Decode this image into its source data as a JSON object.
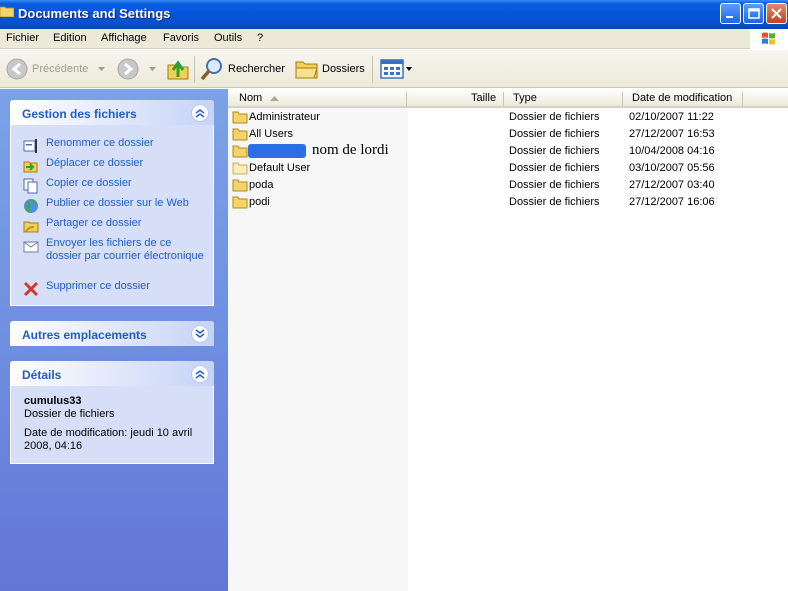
{
  "window": {
    "title": "Documents and Settings"
  },
  "menu": [
    "Fichier",
    "Edition",
    "Affichage",
    "Favoris",
    "Outils",
    "?"
  ],
  "toolbar": {
    "back_label": "Précédente",
    "search_label": "Rechercher",
    "folders_label": "Dossiers"
  },
  "file_tasks": {
    "title": "Gestion des fichiers",
    "items": [
      {
        "label": "Renommer ce dossier",
        "icon": "rename-icon"
      },
      {
        "label": "Déplacer ce dossier",
        "icon": "move-icon"
      },
      {
        "label": "Copier ce dossier",
        "icon": "copy-icon"
      },
      {
        "label": "Publier ce dossier sur le Web",
        "icon": "globe-icon"
      },
      {
        "label": "Partager ce dossier",
        "icon": "share-icon"
      },
      {
        "label": "Envoyer les fichiers de ce dossier par courrier électronique",
        "icon": "mail-icon"
      },
      {
        "label": "Supprimer ce dossier",
        "icon": "delete-icon"
      }
    ]
  },
  "other_places": {
    "title": "Autres emplacements"
  },
  "details": {
    "title": "Détails",
    "name": "cumulus33",
    "type": "Dossier de fichiers",
    "modified": "Date de modification: jeudi 10 avril 2008, 04:16"
  },
  "columns": {
    "name": "Nom",
    "size": "Taille",
    "type": "Type",
    "modified": "Date de modification"
  },
  "files": [
    {
      "name": "Administrateur",
      "type": "Dossier de fichiers",
      "modified": "02/10/2007 11:22"
    },
    {
      "name": "All Users",
      "type": "Dossier de fichiers",
      "modified": "27/12/2007 16:53"
    },
    {
      "name": "",
      "note": "nom de lordi",
      "type": "Dossier de fichiers",
      "modified": "10/04/2008 04:16"
    },
    {
      "name": "Default User",
      "type": "Dossier de fichiers",
      "modified": "03/10/2007 05:56"
    },
    {
      "name": "poda",
      "type": "Dossier de fichiers",
      "modified": "27/12/2007 03:40"
    },
    {
      "name": "podi",
      "type": "Dossier de fichiers",
      "modified": "27/12/2007 16:06"
    }
  ],
  "colors": {
    "title_bar": "#0554d8",
    "left_pane": "#6f8fe0",
    "panel_body": "#d6dff7",
    "link": "#215dc6",
    "redaction": "#2a6fe6"
  }
}
